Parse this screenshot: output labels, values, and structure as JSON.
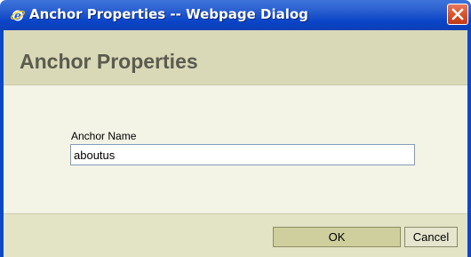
{
  "window": {
    "title": "Anchor Properties -- Webpage Dialog",
    "icon": "ie-icon",
    "close_icon": "close-icon"
  },
  "dialog": {
    "heading": "Anchor Properties",
    "field": {
      "label": "Anchor Name",
      "value": "aboutus",
      "placeholder": ""
    },
    "buttons": {
      "ok": "OK",
      "cancel": "Cancel"
    }
  },
  "colors": {
    "titlebar": "#0b48c8",
    "close": "#d9532e",
    "header_band": "#d9d9b8",
    "ok_button": "#cfcf9e"
  }
}
